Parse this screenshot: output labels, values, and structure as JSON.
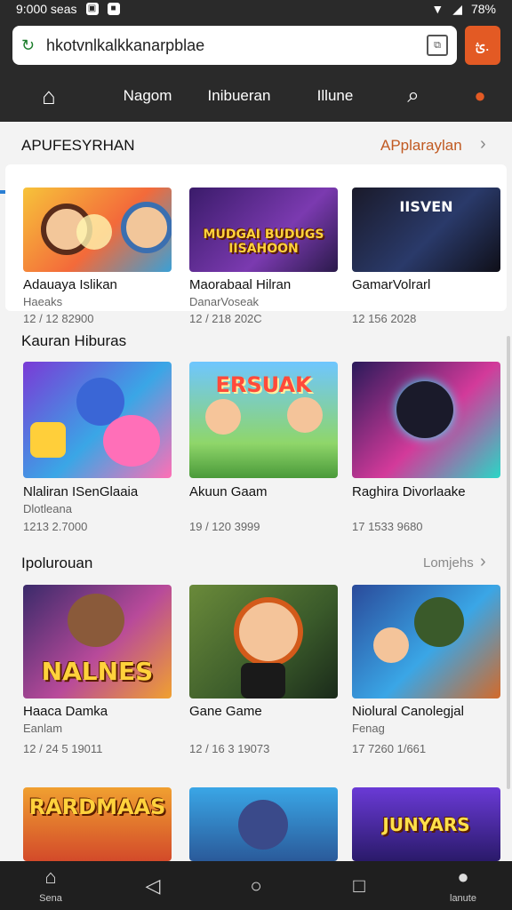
{
  "status": {
    "time": "9:000 seas",
    "battery": "78%"
  },
  "browser": {
    "url": "hkotvnlkalkkanarpblae",
    "extension_icon": "ؿ."
  },
  "nav": {
    "items": [
      "Nagom",
      "Inibueran",
      "Illune"
    ]
  },
  "sections": [
    {
      "title": "APUFESYRHAN",
      "link": "APplaraylan",
      "games": [
        {
          "title": "Adauaya Islikan",
          "sub": "Haeaks",
          "date": "12 / 12 82900"
        },
        {
          "title": "Maorabaal Hilran",
          "sub": "DanarVoseak",
          "date": "12 / 218 202C"
        },
        {
          "title": "GamarVolrarl",
          "sub": "",
          "date": "12 156 2028"
        }
      ]
    },
    {
      "title": "Kauran Hiburas",
      "link": "",
      "games": [
        {
          "title": "Nlaliran ISenGlaaia",
          "sub": "Dlotleana",
          "date": "1213 2.7000"
        },
        {
          "title": "Akuun Gaam",
          "sub": "",
          "date": "19 / 120 3999"
        },
        {
          "title": "Raghira Divorlaake",
          "sub": "",
          "date": "17 1533 9680"
        }
      ]
    },
    {
      "title": "Ipolurouan",
      "link": "Lomjehs",
      "games": [
        {
          "title": "Haaca Damka",
          "sub": "Eanlam",
          "date": "12 / 24 5 19011"
        },
        {
          "title": "Gane Game",
          "sub": "",
          "date": "12 / 16 3 19073"
        },
        {
          "title": "Niolural Canolegjal",
          "sub": "Fenag",
          "date": "17 7260 1/661"
        }
      ]
    }
  ],
  "thumb_captions": [
    "MUDGAI BUDUGS IISAHOON",
    "IISVEN",
    "ERSUAK",
    "NALNES",
    "RARDMAAS",
    "JUNYARS"
  ],
  "bottom_bar": {
    "left_label": "Sena",
    "right_label": "lanute"
  },
  "colors": {
    "accent": "#e35a24",
    "nav_underline": "#2b7fd4",
    "bar": "#2a2a2a"
  }
}
